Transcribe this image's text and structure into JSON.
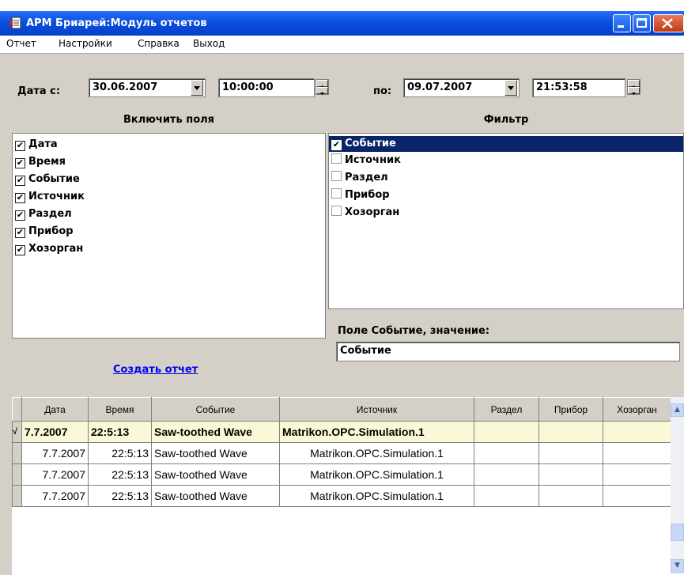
{
  "window": {
    "title": "АРМ Бриарей:Модуль отчетов"
  },
  "menu": {
    "items": [
      "Отчет",
      "Настройки",
      "Справка",
      "Выход"
    ]
  },
  "date_range": {
    "from_label": "Дата с:",
    "from_date": "30.06.2007",
    "from_time": "10:00:00",
    "to_label": "по:",
    "to_date": "09.07.2007",
    "to_time": "21:53:58"
  },
  "fields_panel": {
    "title": "Включить поля",
    "items": [
      {
        "label": "Дата",
        "checked": true
      },
      {
        "label": "Время",
        "checked": true
      },
      {
        "label": "Событие",
        "checked": true
      },
      {
        "label": "Источник",
        "checked": true
      },
      {
        "label": "Раздел",
        "checked": true
      },
      {
        "label": "Прибор",
        "checked": true
      },
      {
        "label": "Хозорган",
        "checked": true
      }
    ],
    "create_report": "Создать отчет"
  },
  "filter_panel": {
    "title": "Фильтр",
    "items": [
      {
        "label": "Событие",
        "checked": true,
        "selected": true
      },
      {
        "label": "Источник",
        "checked": false
      },
      {
        "label": "Раздел",
        "checked": false
      },
      {
        "label": "Прибор",
        "checked": false
      },
      {
        "label": "Хозорган",
        "checked": false
      }
    ],
    "value_label": "Поле Событие, значение:",
    "value": "Событие"
  },
  "grid": {
    "columns": [
      "Дата",
      "Время",
      "Событие",
      "Источник",
      "Раздел",
      "Прибор",
      "Хозорган"
    ],
    "rows": [
      [
        "7.7.2007",
        "22:5:13",
        "Saw-toothed Wave",
        "Matrikon.OPC.Simulation.1",
        "",
        "",
        ""
      ],
      [
        "7.7.2007",
        "22:5:13",
        "Saw-toothed Wave",
        "Matrikon.OPC.Simulation.1",
        "",
        "",
        ""
      ],
      [
        "7.7.2007",
        "22:5:13",
        "Saw-toothed Wave",
        "Matrikon.OPC.Simulation.1",
        "",
        "",
        ""
      ],
      [
        "7.7.2007",
        "22:5:13",
        "Saw-toothed Wave",
        "Matrikon.OPC.Simulation.1",
        "",
        "",
        ""
      ]
    ],
    "current_row": 0
  },
  "colors": {
    "title_bar": "#0a4fe0",
    "selection": "#0a246a",
    "current_row": "#fbf8d7"
  },
  "icons": [
    "app-icon",
    "minimize-icon",
    "maximize-icon",
    "close-icon"
  ]
}
